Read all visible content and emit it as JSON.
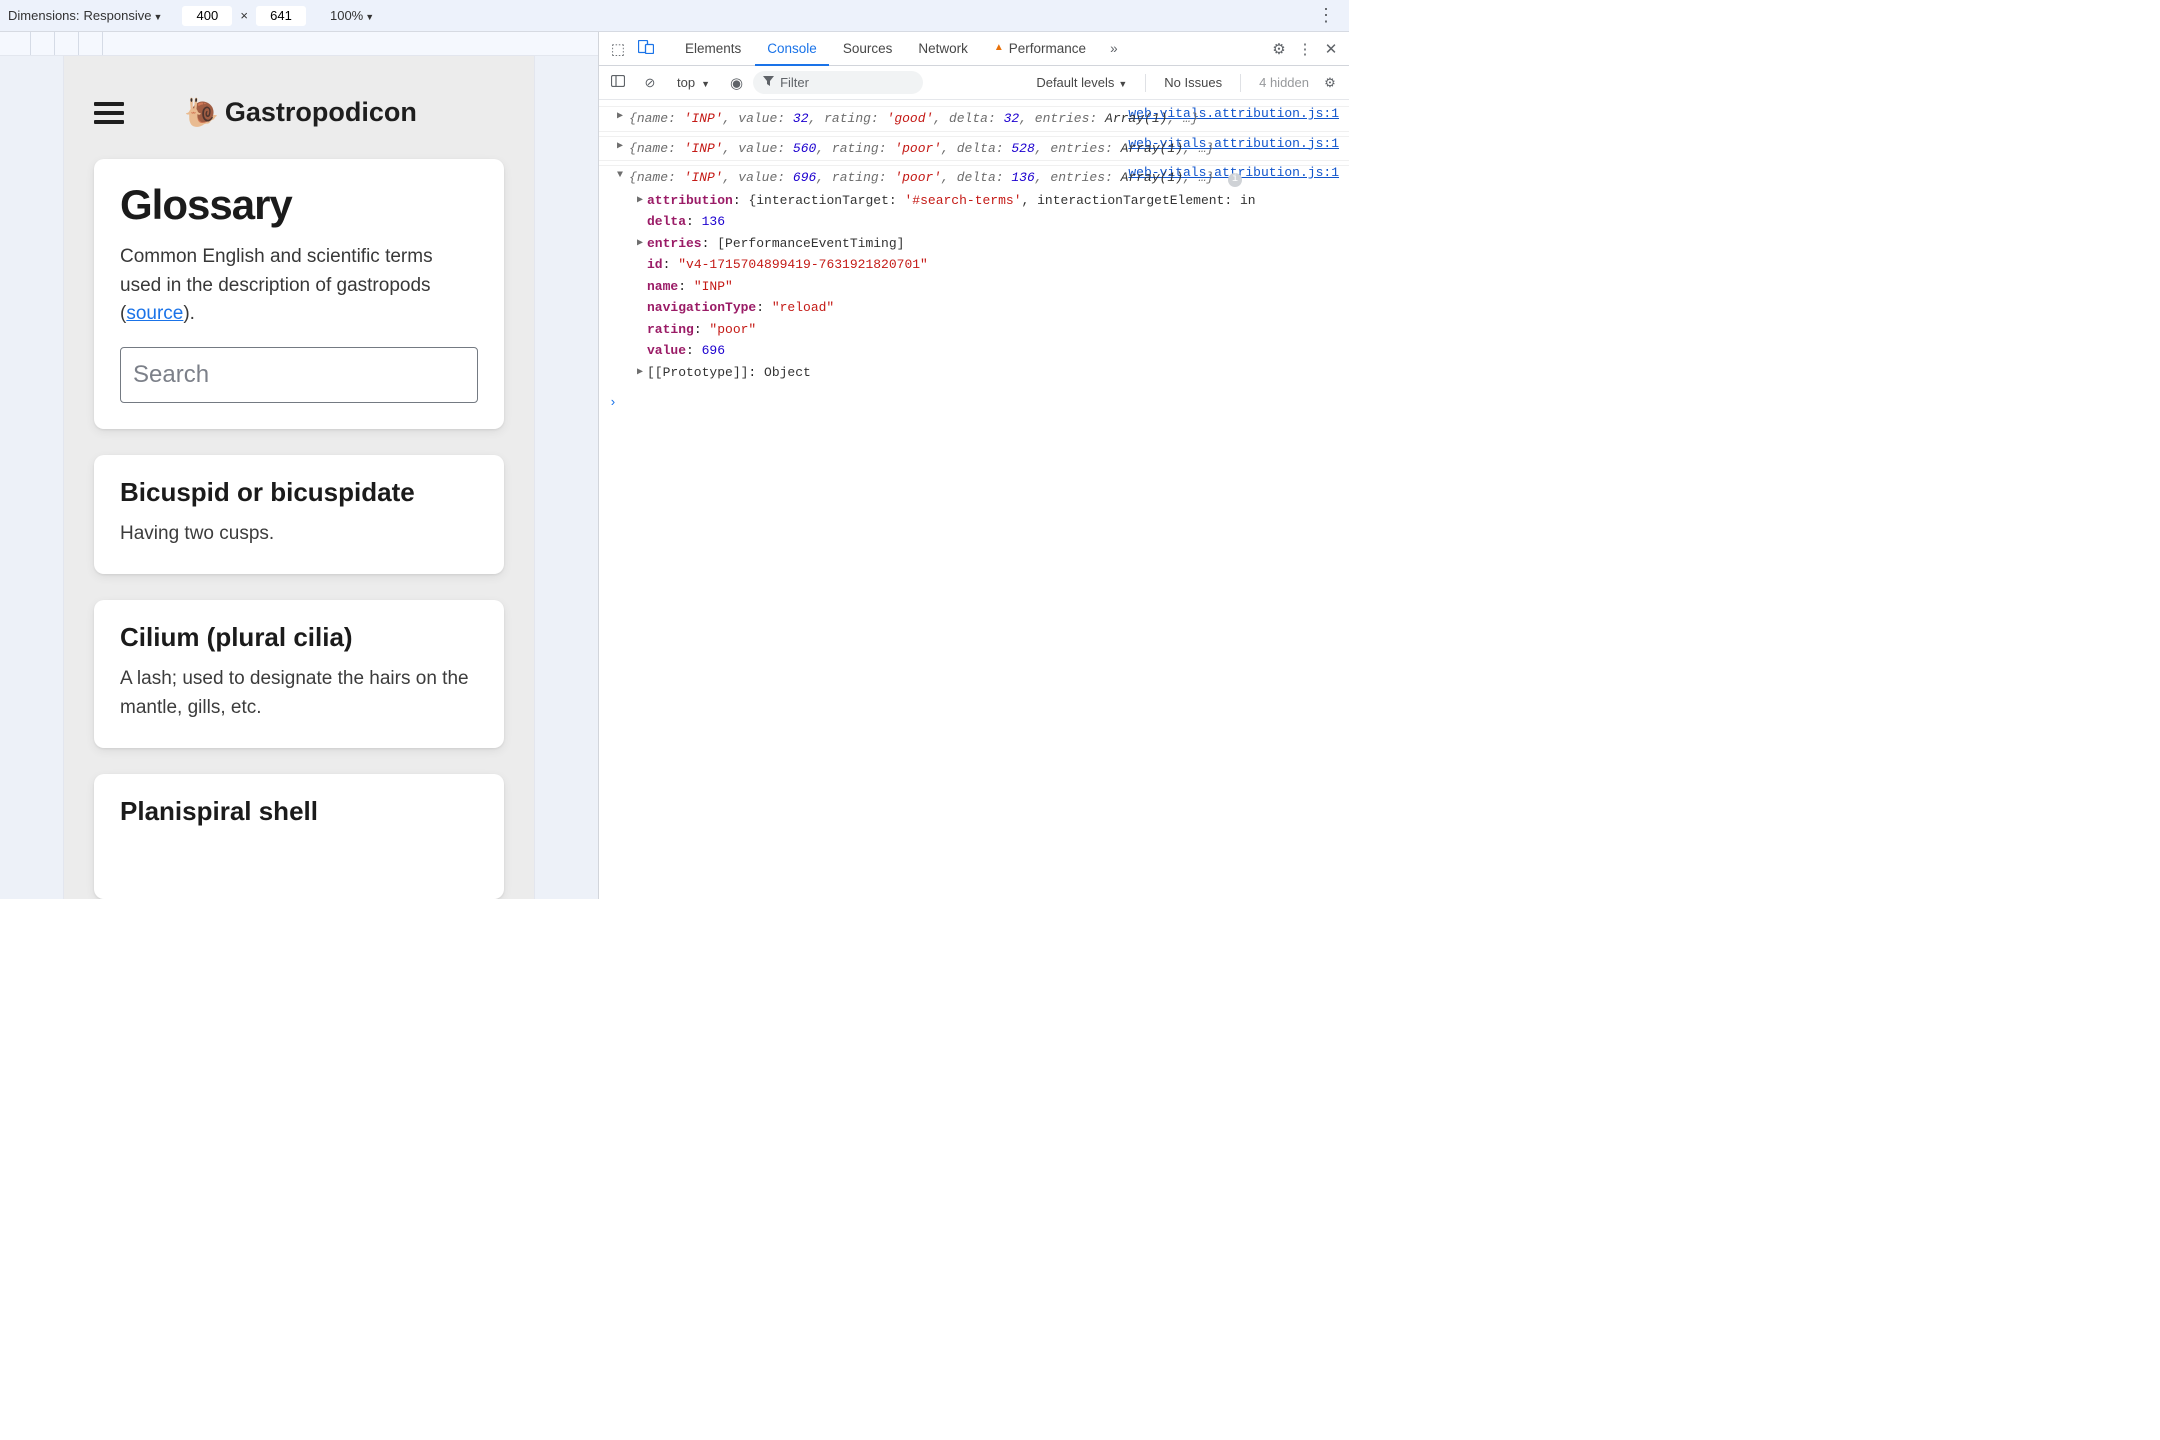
{
  "deviceBar": {
    "dimensionsLabel": "Dimensions:",
    "deviceName": "Responsive",
    "width": "400",
    "height": "641",
    "zoom": "100%"
  },
  "app": {
    "brand": "Gastropodicon",
    "glossaryTitle": "Glossary",
    "lead_pre": "Common English and scientific terms used in the description of gastropods (",
    "lead_link": "source",
    "lead_post": ").",
    "searchPlaceholder": "Search",
    "entries": [
      {
        "term": "Bicuspid or bicuspidate",
        "def": "Having two cusps."
      },
      {
        "term": "Cilium (plural cilia)",
        "def": "A lash; used to designate the hairs on the mantle, gills, etc."
      },
      {
        "term": "Planispiral shell",
        "def": ""
      }
    ]
  },
  "devtools": {
    "tabs": {
      "elements": "Elements",
      "console": "Console",
      "sources": "Sources",
      "network": "Network",
      "performance": "Performance"
    },
    "sub": {
      "context": "top",
      "filterPlaceholder": "Filter",
      "levels": "Default levels",
      "issues": "No Issues",
      "hidden": "4 hidden"
    },
    "srcLink": "web-vitals.attribution.js:1",
    "logs": [
      {
        "name": "INP",
        "value": 32,
        "rating": "good",
        "delta": 32,
        "entries": "Array(1)"
      },
      {
        "name": "INP",
        "value": 560,
        "rating": "poor",
        "delta": 528,
        "entries": "Array(1)"
      },
      {
        "name": "INP",
        "value": 696,
        "rating": "poor",
        "delta": 136,
        "entries": "Array(1)"
      }
    ],
    "expanded": {
      "attribution_label": "attribution",
      "attribution_target_key": "interactionTarget",
      "attribution_target_val": "'#search-terms'",
      "attribution_elem_key": "interactionTargetElement",
      "attribution_elem_val": "in",
      "delta_k": "delta",
      "delta_v": 136,
      "entries_k": "entries",
      "entries_v": "[PerformanceEventTiming]",
      "id_k": "id",
      "id_v": "\"v4-1715704899419-7631921820701\"",
      "name_k": "name",
      "name_v": "\"INP\"",
      "nav_k": "navigationType",
      "nav_v": "\"reload\"",
      "rating_k": "rating",
      "rating_v": "\"poor\"",
      "value_k": "value",
      "value_v": 696,
      "proto_k": "[[Prototype]]",
      "proto_v": "Object"
    }
  }
}
